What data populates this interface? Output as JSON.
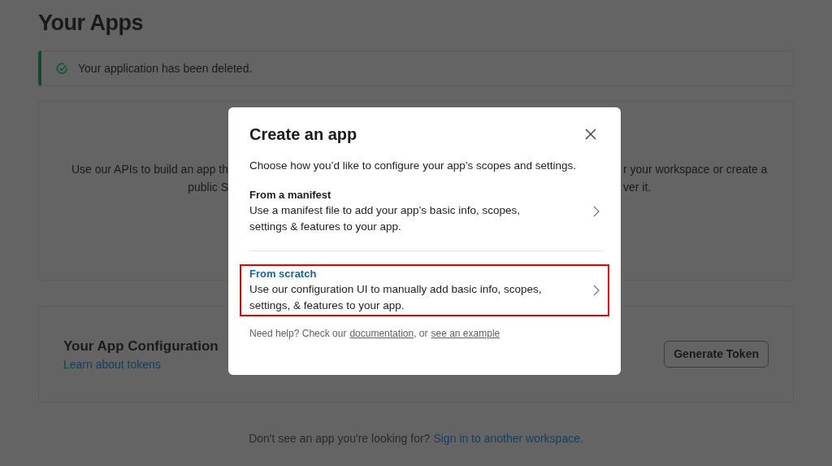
{
  "page": {
    "title": "Your Apps"
  },
  "banner": {
    "message": "Your application has been deleted."
  },
  "intro": {
    "left_lines": [
      "Use our APIs to build an app th",
      "public S"
    ],
    "right_lines": [
      "r your workspace or create a",
      "ver it."
    ]
  },
  "token_card": {
    "title": "Your App Configuration",
    "link": "Learn about tokens",
    "button": "Generate Token"
  },
  "footer": {
    "text": "Don't see an app you're looking for?",
    "link": "Sign in to another workspace."
  },
  "modal": {
    "title": "Create an app",
    "description": "Choose how you’d like to configure your app’s scopes and settings.",
    "options": [
      {
        "title": "From a manifest",
        "description": "Use a manifest file to add your app’s basic info, scopes, settings & features to your app.",
        "selected": false
      },
      {
        "title": "From scratch",
        "description": "Use our configuration UI to manually add basic info, scopes, settings, & features to your app.",
        "selected": true
      }
    ],
    "help": {
      "text": "Need help? Check our",
      "link1": "documentation",
      "separator": ", or",
      "link2": "see an example"
    }
  }
}
